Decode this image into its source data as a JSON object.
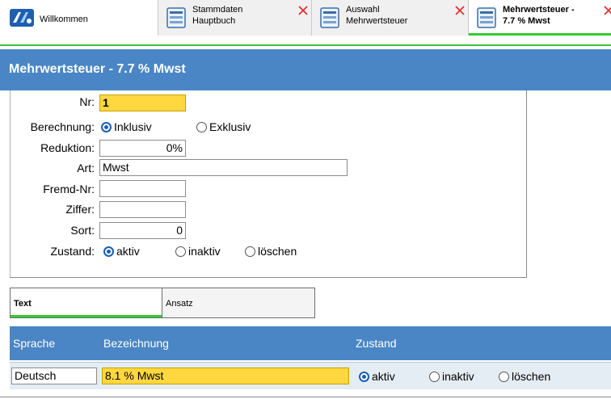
{
  "tabs": {
    "home": {
      "label": "Willkommen"
    },
    "items": [
      {
        "line1": "Stammdaten",
        "line2": "Hauptbuch"
      },
      {
        "line1": "Auswahl",
        "line2": "Mehrwertsteuer"
      },
      {
        "line1": "Mehrwertsteuer -",
        "line2": "7.7 % Mwst"
      }
    ]
  },
  "page": {
    "title": "Mehrwertsteuer - 7.7 % Mwst"
  },
  "form": {
    "nr": {
      "label": "Nr:",
      "value": "1"
    },
    "berechnung": {
      "label": "Berechnung:",
      "options": [
        "Inklusiv",
        "Exklusiv"
      ],
      "selected": "Inklusiv"
    },
    "reduktion": {
      "label": "Reduktion:",
      "value": "0%"
    },
    "art": {
      "label": "Art:",
      "value": "Mwst"
    },
    "fremd_nr": {
      "label": "Fremd-Nr:",
      "value": ""
    },
    "ziffer": {
      "label": "Ziffer:",
      "value": ""
    },
    "sort": {
      "label": "Sort:",
      "value": "0"
    },
    "zustand": {
      "label": "Zustand:",
      "options": [
        "aktiv",
        "inaktiv",
        "löschen"
      ],
      "selected": "aktiv"
    }
  },
  "subtabs": [
    {
      "label": "Text",
      "active": true
    },
    {
      "label": "Ansatz",
      "active": false
    }
  ],
  "grid": {
    "columns": [
      "Sprache",
      "Bezeichnung",
      "Zustand"
    ],
    "rows": [
      {
        "sprache": "Deutsch",
        "bezeichnung": "8.1 % Mwst",
        "zustand_options": [
          "aktiv",
          "inaktiv",
          "löschen"
        ],
        "zustand": "aktiv"
      }
    ]
  },
  "colors": {
    "header_blue": "#4a86c5",
    "active_green": "#33cc33",
    "highlight_yellow": "#ffd740",
    "close_red": "#e03030"
  }
}
